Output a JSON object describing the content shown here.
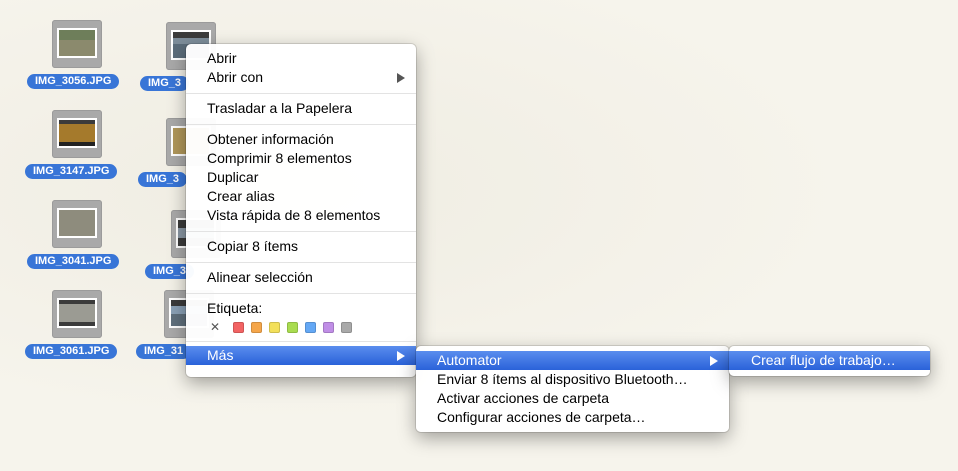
{
  "desktop_icons": [
    {
      "label": "IMG_3056.JPG"
    },
    {
      "label": "IMG_3"
    },
    {
      "label": "IMG_3147.JPG"
    },
    {
      "label": "IMG_3"
    },
    {
      "label": "IMG_3041.JPG"
    },
    {
      "label": "IMG_3"
    },
    {
      "label": "IMG_3061.JPG"
    },
    {
      "label": "IMG_31"
    }
  ],
  "context_menu": {
    "open": "Abrir",
    "open_with": "Abrir con",
    "trash": "Trasladar a la Papelera",
    "get_info": "Obtener información",
    "compress": "Comprimir 8 elementos",
    "duplicate": "Duplicar",
    "alias": "Crear alias",
    "quicklook": "Vista rápida de 8 elementos",
    "copy": "Copiar 8 ítems",
    "align": "Alinear selección",
    "tag_label": "Etiqueta:",
    "more": "Más"
  },
  "tag_colors": [
    "#f26363",
    "#f5a64a",
    "#f3e05b",
    "#a9dc50",
    "#64a8f5",
    "#c08ee6",
    "#a9a9a9"
  ],
  "submenu_mas": {
    "automator": "Automator",
    "bluetooth": "Enviar 8 ítems al dispositivo Bluetooth…",
    "activate": "Activar acciones de carpeta",
    "configure": "Configurar acciones de carpeta…"
  },
  "submenu_automator": {
    "create_workflow": "Crear flujo de trabajo…"
  },
  "colors": {
    "selection": "#3875d7",
    "menu_highlight": "#2a62d9"
  }
}
